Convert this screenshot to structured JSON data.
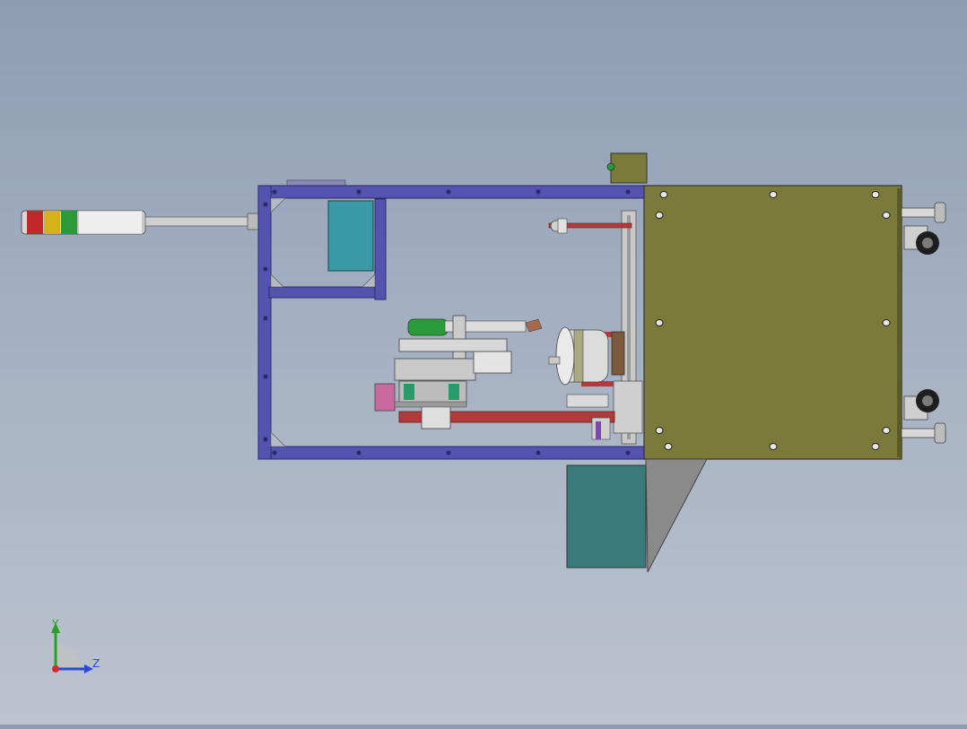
{
  "viewport": {
    "background_top": "#8e9db3",
    "background_bottom": "#bcc3cf"
  },
  "model": {
    "frame_color": "#4a4aa8",
    "cabinet_color": "#7a7a3a",
    "panel_teal": "#3a7a7a",
    "rod_red": "#b33a3a",
    "motor_green": "#2a9a3a",
    "signal_tower_colors": [
      "#c0282a",
      "#d6b21a",
      "#2a9a3a",
      "#e6e6e6"
    ]
  },
  "triad": {
    "y_label": "Y",
    "z_label": "Z",
    "y_color": "#2aa02a",
    "z_color": "#2a4ad6",
    "x_color": "#d62a2a"
  }
}
